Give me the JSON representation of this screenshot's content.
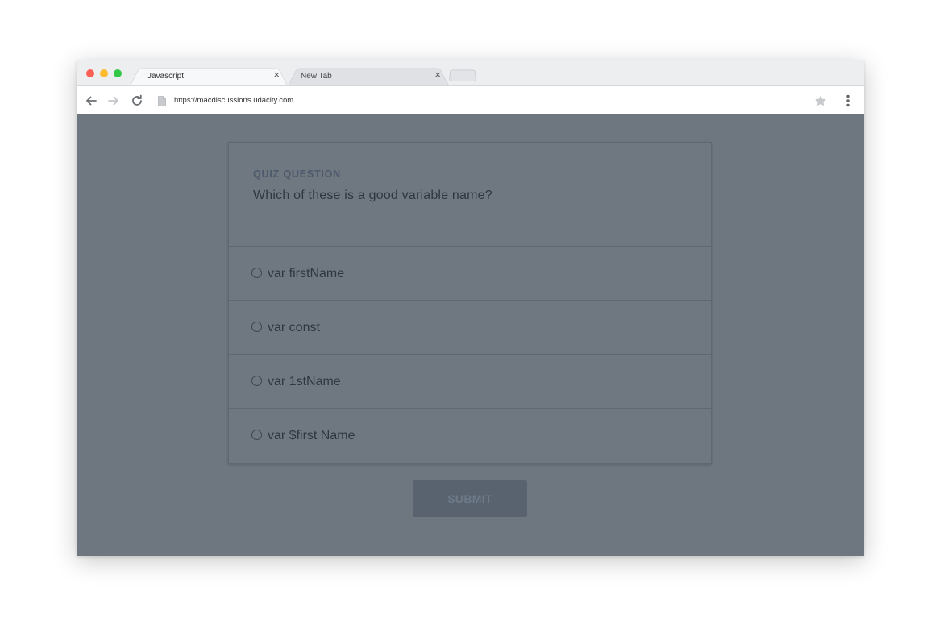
{
  "browser": {
    "tabs": [
      {
        "title": "Javascript",
        "close": "×"
      },
      {
        "title": "New Tab",
        "close": "×"
      }
    ],
    "url": "https://macdiscussions.udacity.com"
  },
  "quiz": {
    "label": "QUIZ QUESTION",
    "question": "Which of these is a good variable name?",
    "options": [
      {
        "label": "var firstName"
      },
      {
        "label": "var const"
      },
      {
        "label": "var 1stName"
      },
      {
        "label": "var $first Name"
      }
    ],
    "submit_label": "SUBMIT"
  },
  "icons": {
    "back": "arrow-left-icon",
    "forward": "arrow-right-icon",
    "reload": "reload-icon",
    "page": "page-icon",
    "bookmark": "star-icon",
    "menu": "kebab-menu-icon"
  },
  "colors": {
    "overlay": "#6e7780",
    "submit_bg": "#58636f",
    "label": "#4d5a6c"
  }
}
